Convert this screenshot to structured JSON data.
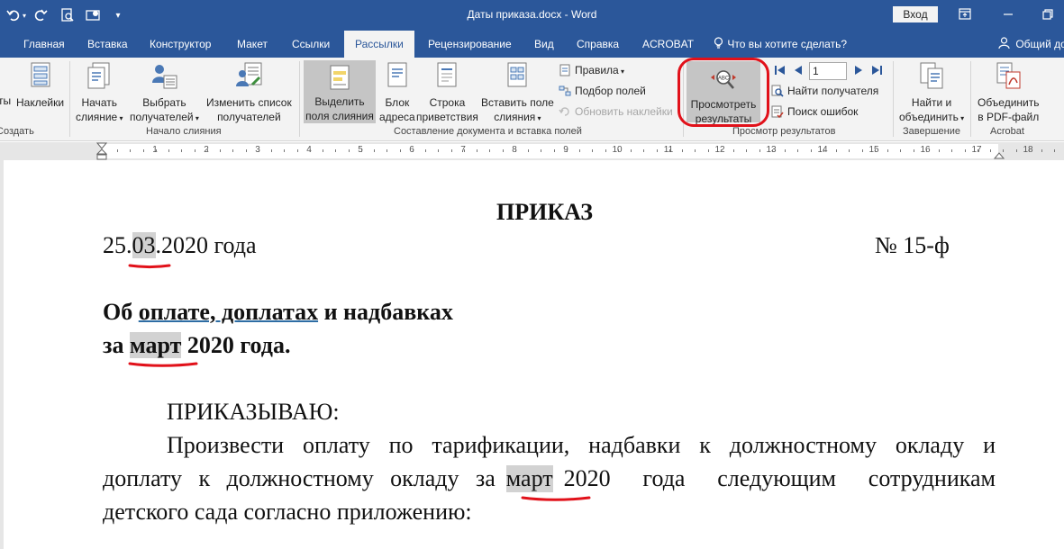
{
  "title_bar": {
    "title": "Даты приказа.docx - Word",
    "signin_label": "Вход"
  },
  "tabs": [
    {
      "label": "Главная"
    },
    {
      "label": "Вставка"
    },
    {
      "label": "Конструктор"
    },
    {
      "label": "Макет"
    },
    {
      "label": "Ссылки"
    },
    {
      "label": "Рассылки",
      "active": true
    },
    {
      "label": "Рецензирование"
    },
    {
      "label": "Вид"
    },
    {
      "label": "Справка"
    },
    {
      "label": "ACROBAT"
    }
  ],
  "tell_me": "Что вы хотите сделать?",
  "share": "Общий до",
  "ribbon": {
    "create": {
      "envelopes": "ты",
      "labels": "Наклейки",
      "group_label": "Создать"
    },
    "start_merge": {
      "start_line1": "Начать",
      "start_line2": "слияние",
      "select_line1": "Выбрать",
      "select_line2": "получателей",
      "edit_line1": "Изменить список",
      "edit_line2": "получателей",
      "group_label": "Начало слияния"
    },
    "write_insert": {
      "highlight_line1": "Выделить",
      "highlight_line2": "поля слияния",
      "address_line1": "Блок",
      "address_line2": "адреса",
      "greeting_line1": "Строка",
      "greeting_line2": "приветствия",
      "insert_line1": "Вставить поле",
      "insert_line2": "слияния",
      "rules": "Правила",
      "match_fields": "Подбор полей",
      "update_labels": "Обновить наклейки",
      "group_label": "Составление документа и вставка полей"
    },
    "preview": {
      "preview_line1": "Просмотреть",
      "preview_line2": "результаты",
      "record_number": "1",
      "find_recipient": "Найти получателя",
      "check_errors": "Поиск ошибок",
      "group_label": "Просмотр результатов"
    },
    "finish": {
      "finish_line1": "Найти и",
      "finish_line2": "объединить",
      "group_label": "Завершение"
    },
    "acrobat": {
      "merge_line1": "Объединить",
      "merge_line2": "в PDF-файл",
      "group_label": "Acrobat"
    }
  },
  "ruler": {
    "numbers": [
      "1",
      "2",
      "3",
      "4",
      "5",
      "6",
      "7",
      "8",
      "9",
      "10",
      "11",
      "12",
      "13",
      "14",
      "15",
      "16",
      "17",
      "18"
    ]
  },
  "document": {
    "heading": "ПРИКАЗ",
    "date_day": "25.",
    "date_month_field": "03",
    "date_rest": ".2020 года",
    "order_number": "№ 15-ф",
    "subject_prefix": "Об",
    "subject_underlined": "оплате,  доплатах",
    "subject_suffix": "и надбавках",
    "subject2_prefix": "за",
    "subject2_field": "март",
    "subject2_suffix": "2020 года.",
    "order_word": "ПРИКАЗЫВАЮ:",
    "p1_line1": "Произвести оплату по тарификации, надбавки к должностному окладу и",
    "p1_line2_a": "доплату к должностному окладу за",
    "p1_line2_field": "март",
    "p1_line2_b": "2020 года следующим сотрудникам",
    "p1_line3": "детского сада согласно приложению:"
  },
  "colors": {
    "title_bar": "#2b579a",
    "ribbon": "#f3f3f3",
    "highlight_ring": "#e1111a",
    "field_shading": "#d2d2d2"
  }
}
